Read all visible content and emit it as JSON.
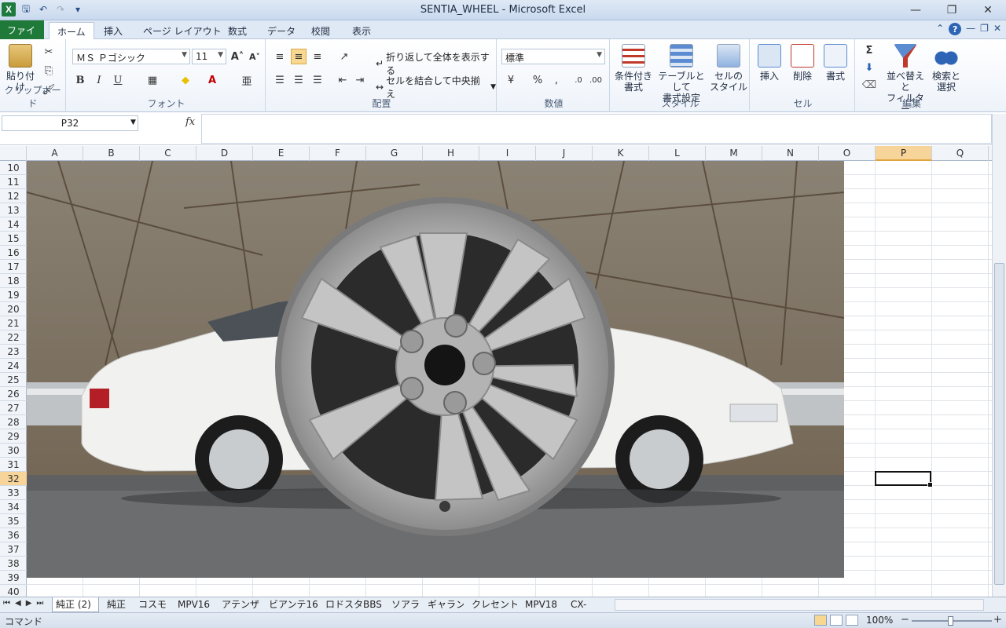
{
  "window": {
    "title": "SENTIA_WHEEL  -  Microsoft Excel",
    "controls": [
      "minimize",
      "restore",
      "close"
    ]
  },
  "ribbon_tabs": [
    "ファイル",
    "ホーム",
    "挿入",
    "ページ レイアウト",
    "数式",
    "データ",
    "校閲",
    "表示"
  ],
  "active_tab": "ホーム",
  "ribbon": {
    "clipboard": {
      "paste": "貼り付け",
      "label": "クリップボード"
    },
    "font": {
      "name": "ＭＳ Ｐゴシック",
      "size": "11",
      "label": "フォント"
    },
    "alignment": {
      "wrap": "折り返して全体を表示する",
      "merge": "セルを結合して中央揃え",
      "label": "配置"
    },
    "number": {
      "format": "標準",
      "label": "数値"
    },
    "styles": {
      "conditional": "条件付き\n書式",
      "table": "テーブルとして\n書式設定",
      "cell": "セルの\nスタイル",
      "label": "スタイル"
    },
    "cells": {
      "insert": "挿入",
      "delete": "削除",
      "format": "書式",
      "label": "セル"
    },
    "editing": {
      "sort": "並べ替えと\nフィルター",
      "find": "検索と\n選択",
      "label": "編集"
    }
  },
  "formula_bar": {
    "name_box": "P32",
    "fx": "fx",
    "content": ""
  },
  "columns": [
    "A",
    "B",
    "C",
    "D",
    "E",
    "F",
    "G",
    "H",
    "I",
    "J",
    "K",
    "L",
    "M",
    "N",
    "O",
    "P",
    "Q"
  ],
  "selected_column": "P",
  "rows": [
    "10",
    "11",
    "12",
    "13",
    "14",
    "15",
    "16",
    "17",
    "18",
    "19",
    "20",
    "21",
    "22",
    "23",
    "24",
    "25",
    "26",
    "27",
    "28",
    "29",
    "30",
    "31",
    "32",
    "33",
    "34",
    "35",
    "36",
    "37",
    "38",
    "39",
    "40"
  ],
  "selected_row": "32",
  "active_cell": "P32",
  "sheet_tabs": [
    "純正 (2)",
    "純正",
    "コスモ",
    "MPV16",
    "アテンザ",
    "ビアンテ16",
    "ロドスタBBS",
    "ソアラ",
    "ギャラン",
    "クレセント",
    "MPV18",
    "CX-"
  ],
  "active_sheet": "純正 (2)",
  "status": {
    "mode": "コマンド",
    "zoom": "100%"
  },
  "image": {
    "subject": "alloy-wheel-over-white-sedan-photo"
  }
}
